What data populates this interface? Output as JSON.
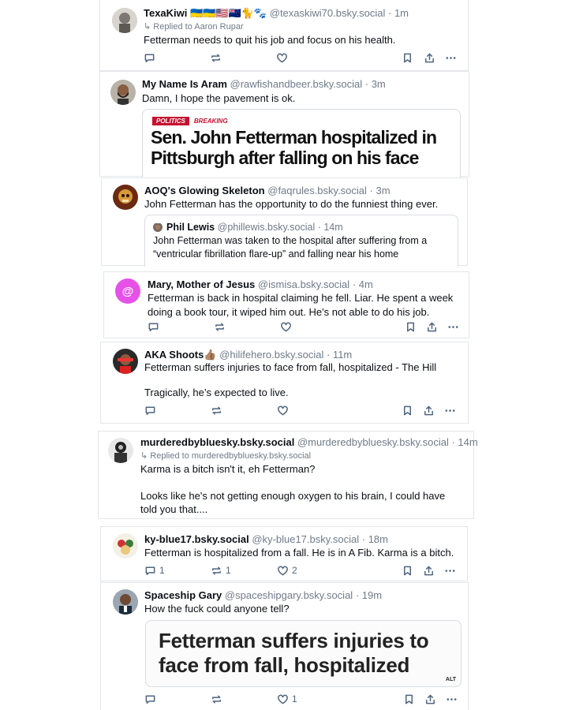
{
  "posts": [
    {
      "name": "TexaKiwi 🇺🇦🇺🇦🇺🇸🇳🇿🐈🐾",
      "handle": "@texaskiwi70.bsky.social",
      "time": "· 1m",
      "reply_to": "↳ Replied to Aaron Rupar",
      "text": "Fetterman needs to quit his job and focus on his health.",
      "counts": {
        "reply": "",
        "repost": "",
        "like": ""
      }
    },
    {
      "name": "My Name Is Aram",
      "handle": "@rawfishandbeer.bsky.social",
      "time": "· 3m",
      "text": "Damn, I hope the pavement is ok.",
      "embed": {
        "tag1": "POLITICS",
        "tag2": "BREAKING",
        "headline": "Sen. John Fetterman hospitalized in Pittsburgh after falling on his face"
      }
    },
    {
      "name": "AOQ's Glowing Skeleton",
      "handle": "@faqrules.bsky.social",
      "time": "· 3m",
      "text": "John Fetterman has the opportunity to do the funniest thing ever.",
      "quote": {
        "name": "Phil Lewis",
        "handle": "@phillewis.bsky.social",
        "time": "· 14m",
        "text": "John Fetterman was taken to the hospital after suffering from a “ventricular fibrillation flare-up” and falling near his home"
      }
    },
    {
      "name": "Mary, Mother of Jesus",
      "handle": "@ismisa.bsky.social",
      "time": "· 4m",
      "text": "Fetterman is back in hospital claiming he fell. Liar. He spent a week doing a book tour, it wiped him out. He's not able to do his job.",
      "counts": {
        "reply": "",
        "repost": "",
        "like": ""
      }
    },
    {
      "name": "AKA Shoots👍🏽",
      "handle": "@hilifehero.bsky.social",
      "time": "· 11m",
      "text": "Fetterman suffers injuries to face from fall, hospitalized - The Hill\n\nTragically, he’s expected to live.",
      "counts": {
        "reply": "",
        "repost": "",
        "like": ""
      }
    },
    {
      "name": "murderedbybluesky.bsky.social",
      "handle": "@murderedbybluesky.bsky.social",
      "time": "· 14m",
      "reply_to": "↳ Replied to murderedbybluesky.bsky.social",
      "text": "Karma is a bitch isn't it, eh Fetterman?\n\nLooks like he's not getting enough oxygen to his brain, I could have told you that...."
    },
    {
      "name": "ky-blue17.bsky.social",
      "handle": "@ky-blue17.bsky.social",
      "time": "· 18m",
      "text": "Fetterman is hospitalized from a fall. He is in A Fib. Karma is a bitch.",
      "counts": {
        "reply": "1",
        "repost": "1",
        "like": "2"
      }
    },
    {
      "name": "Spaceship Gary",
      "handle": "@spaceshipgary.bsky.social",
      "time": "· 19m",
      "text": "How the fuck could anyone tell?",
      "embed": {
        "headline": "Fetterman suffers injuries to face from fall, hospitalized",
        "alt": "ALT"
      },
      "counts": {
        "reply": "",
        "repost": "",
        "like": "1"
      }
    }
  ],
  "colors": {
    "mary_avatar": "#e651e8",
    "politics_tag": "#c8102e",
    "breaking_tag": "#c8102e",
    "handle": "#6f7b89",
    "action_icon": "#4f6580"
  },
  "icons": [
    "reply-icon",
    "repost-icon",
    "like-icon",
    "bookmark-icon",
    "share-icon",
    "more-icon",
    "at-icon"
  ]
}
